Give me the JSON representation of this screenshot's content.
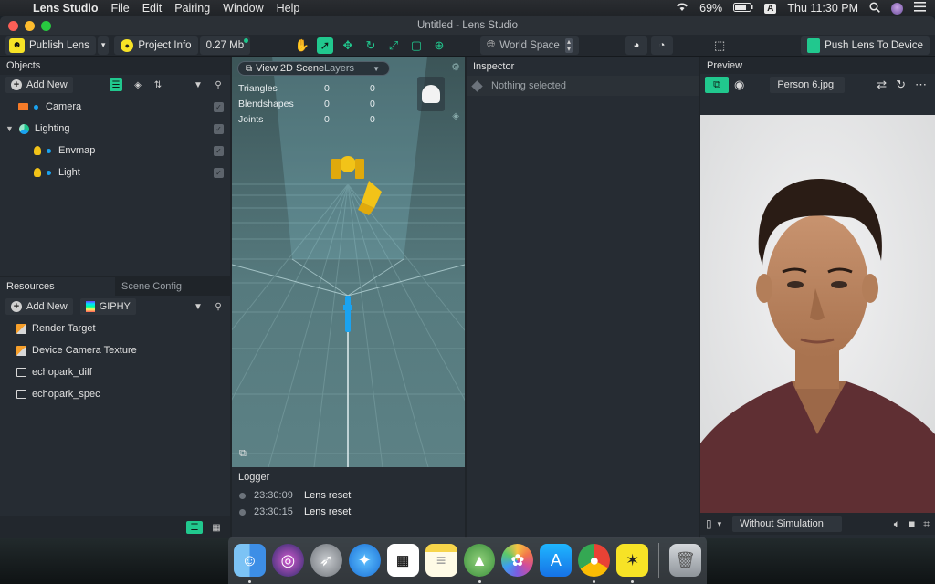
{
  "menubar": {
    "app_name": "Lens Studio",
    "menus": [
      "File",
      "Edit",
      "Pairing",
      "Window",
      "Help"
    ],
    "battery": "69%",
    "input_badge": "A",
    "clock": "Thu 11:30 PM"
  },
  "window": {
    "title": "Untitled - Lens Studio"
  },
  "toolbar": {
    "publish_label": "Publish Lens",
    "project_info_label": "Project Info",
    "size_label": "0.27 Mb",
    "space_label": "World Space",
    "push_label": "Push Lens To Device"
  },
  "objects": {
    "title": "Objects",
    "add_label": "Add New",
    "items": [
      {
        "label": "Camera"
      },
      {
        "label": "Lighting"
      },
      {
        "label": "Envmap"
      },
      {
        "label": "Light"
      }
    ]
  },
  "resources": {
    "tab_active": "Resources",
    "tab_inactive": "Scene Config",
    "add_label": "Add New",
    "giphy_label": "GIPHY",
    "items": [
      {
        "label": "Render Target"
      },
      {
        "label": "Device Camera Texture"
      },
      {
        "label": "echopark_diff"
      },
      {
        "label": "echopark_spec"
      }
    ]
  },
  "viewport": {
    "view_button": "View 2D Scene",
    "layers_label": "Layers",
    "stats": [
      {
        "label": "Triangles",
        "v1": "0",
        "v2": "0"
      },
      {
        "label": "Blendshapes",
        "v1": "0",
        "v2": "0"
      },
      {
        "label": "Joints",
        "v1": "0",
        "v2": "0"
      }
    ]
  },
  "logger": {
    "title": "Logger",
    "entries": [
      {
        "time": "23:30:09",
        "message": "Lens reset"
      },
      {
        "time": "23:30:15",
        "message": "Lens reset"
      }
    ]
  },
  "inspector": {
    "title": "Inspector",
    "empty_text": "Nothing selected"
  },
  "preview": {
    "title": "Preview",
    "image_label": "Person 6.jpg",
    "simulation_label": "Without Simulation"
  },
  "colors": {
    "accent": "#21c88e",
    "snap_yellow": "#f7e326",
    "panel_bg": "#262c33"
  }
}
